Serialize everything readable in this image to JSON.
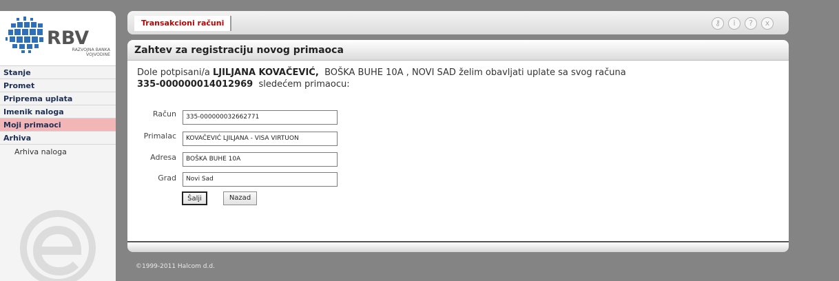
{
  "logo": {
    "brand": "RBV",
    "subtitle_line1": "RAZVOJNA BANKA",
    "subtitle_line2": "VOJVODINE"
  },
  "sidebar": {
    "items": [
      {
        "label": "Stanje"
      },
      {
        "label": "Promet"
      },
      {
        "label": "Priprema uplata"
      },
      {
        "label": "Imenik naloga"
      },
      {
        "label": "Moji primaoci",
        "active": true
      },
      {
        "label": "Arhiva"
      }
    ],
    "sub_items": [
      {
        "label": "Arhiva naloga"
      }
    ]
  },
  "topbar": {
    "tab_label": "Transakcioni računi",
    "tools": [
      "key-icon",
      "info-icon",
      "help-icon",
      "close-icon"
    ]
  },
  "panel": {
    "title": "Zahtev za registraciju novog primaoca",
    "intro": {
      "prefix": "Dole potpisani/a",
      "name": "LJILJANA KOVAČEVIĆ,",
      "middle": "BOŠKA BUHE 10A , NOVI SAD  želim obavljati uplate sa svog računa",
      "account": "335-000000014012969",
      "suffix": "sledećem primaocu:"
    },
    "form": {
      "racun_label": "Račun",
      "racun_value": "335-000000032662771",
      "primalac_label": "Primalac",
      "primalac_value": "KOVAČEVIĆ LJILJANA - VISA VIRTUON",
      "adresa_label": "Adresa",
      "adresa_value": "BOŠKA BUHE 10A",
      "grad_label": "Grad",
      "grad_value": "Novi Sad",
      "send_label": "Šalji",
      "back_label": "Nazad"
    }
  },
  "footer": {
    "copyright": "©1999-2011 Halcom d.d."
  },
  "colors": {
    "accent": "#c00000",
    "nav_text": "#1d2f55",
    "active_nav": "#f2b6b6",
    "background": "#848484"
  }
}
